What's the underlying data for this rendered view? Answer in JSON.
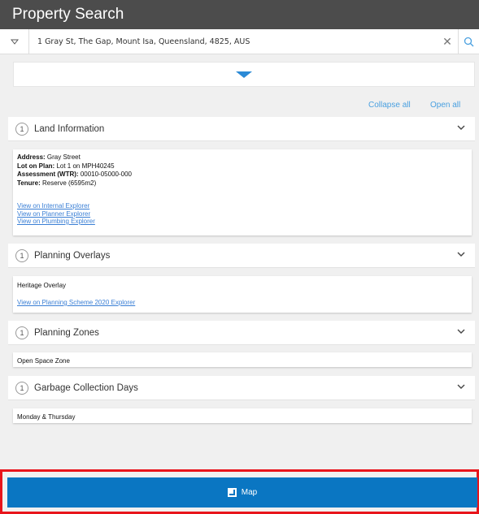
{
  "app": {
    "title": "Property Search"
  },
  "search": {
    "value": "1 Gray St, The Gap, Mount Isa, Queensland, 4825, AUS",
    "clear_symbol": "✕"
  },
  "actions": {
    "collapse_all": "Collapse all",
    "open_all": "Open all"
  },
  "sections": [
    {
      "count": "1",
      "title": "Land Information",
      "details": [
        {
          "label": "Address:",
          "value": "Gray Street"
        },
        {
          "label": "Lot on Plan:",
          "value": "Lot 1 on MPH40245"
        },
        {
          "label": "Assessment (WTR):",
          "value": "00010-05000-000"
        },
        {
          "label": "Tenure:",
          "value": "Reserve (6595m2)"
        }
      ],
      "links": [
        "View on Internal Explorer",
        "View on Planner Explorer",
        "View on Plumbing Explorer"
      ]
    },
    {
      "count": "1",
      "title": "Planning Overlays",
      "item": "Heritage Overlay",
      "link": "View on Planning Scheme 2020 Explorer"
    },
    {
      "count": "1",
      "title": "Planning Zones",
      "item": "Open Space Zone"
    },
    {
      "count": "1",
      "title": "Garbage Collection Days",
      "item": "Monday & Thursday"
    }
  ],
  "footer": {
    "map_label": "Map"
  },
  "colors": {
    "accent": "#0a76c2",
    "highlight": "#e8141b",
    "titlebar": "#4c4c4c"
  }
}
